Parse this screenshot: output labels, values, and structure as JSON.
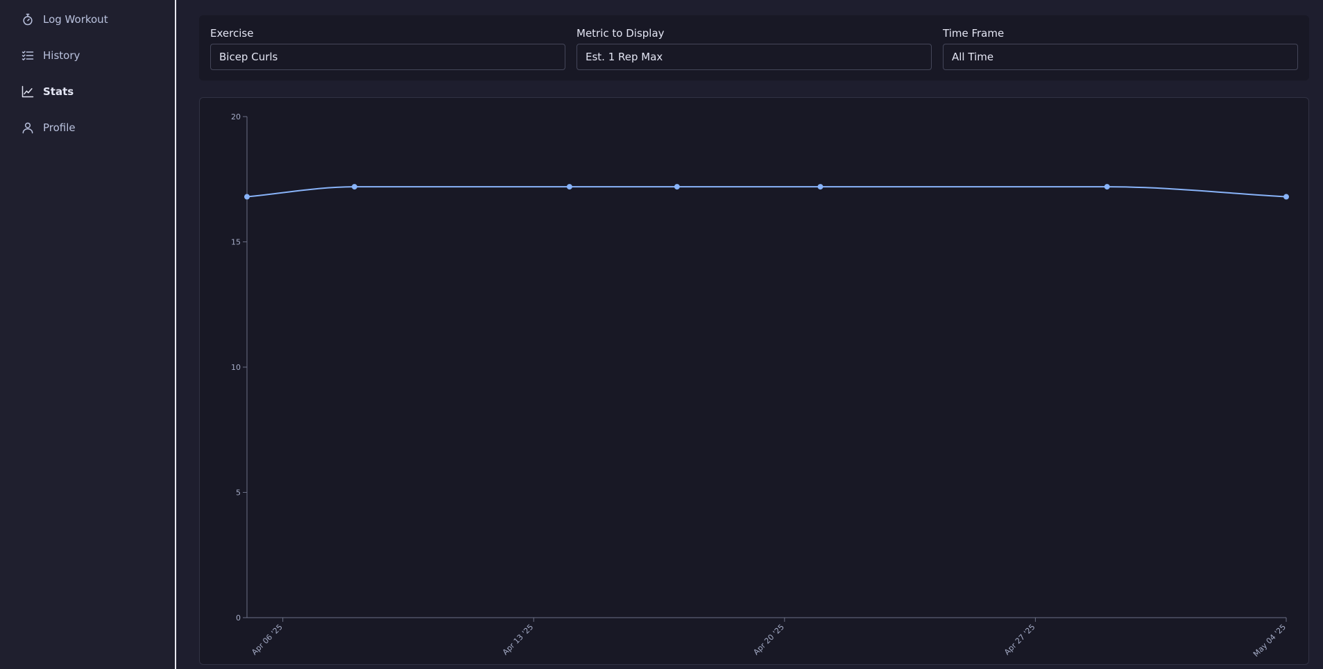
{
  "sidebar": {
    "items": [
      {
        "label": "Log Workout",
        "icon": "stopwatch-icon"
      },
      {
        "label": "History",
        "icon": "checklist-icon"
      },
      {
        "label": "Stats",
        "icon": "line-chart-icon",
        "active": true
      },
      {
        "label": "Profile",
        "icon": "user-icon"
      }
    ]
  },
  "filters": {
    "exercise": {
      "label": "Exercise",
      "value": "Bicep Curls"
    },
    "metric": {
      "label": "Metric to Display",
      "value": "Est. 1 Rep Max"
    },
    "timeframe": {
      "label": "Time Frame",
      "value": "All Time"
    }
  },
  "colors": {
    "line": "#89b4fa",
    "axis": "#6c7086",
    "background": "#181825"
  },
  "chart_data": {
    "type": "line",
    "title": "",
    "xlabel": "",
    "ylabel": "",
    "ylim": [
      0,
      20
    ],
    "yticks": [
      0,
      5,
      10,
      15,
      20
    ],
    "xlim": [
      "2025-04-05",
      "2025-05-04"
    ],
    "xticks": [
      "2025-04-06",
      "2025-04-13",
      "2025-04-20",
      "2025-04-27",
      "2025-05-04"
    ],
    "xtick_labels": [
      "Apr 06 '25",
      "Apr 13 '25",
      "Apr 20 '25",
      "Apr 27 '25",
      "May 04 '25"
    ],
    "grid": false,
    "curve": "smooth",
    "series": [
      {
        "x": [
          "2025-04-05",
          "2025-04-08",
          "2025-04-14",
          "2025-04-17",
          "2025-04-21",
          "2025-04-29",
          "2025-05-04"
        ],
        "y": [
          16.8,
          17.2,
          17.2,
          17.2,
          17.2,
          17.2,
          16.8
        ]
      }
    ]
  }
}
